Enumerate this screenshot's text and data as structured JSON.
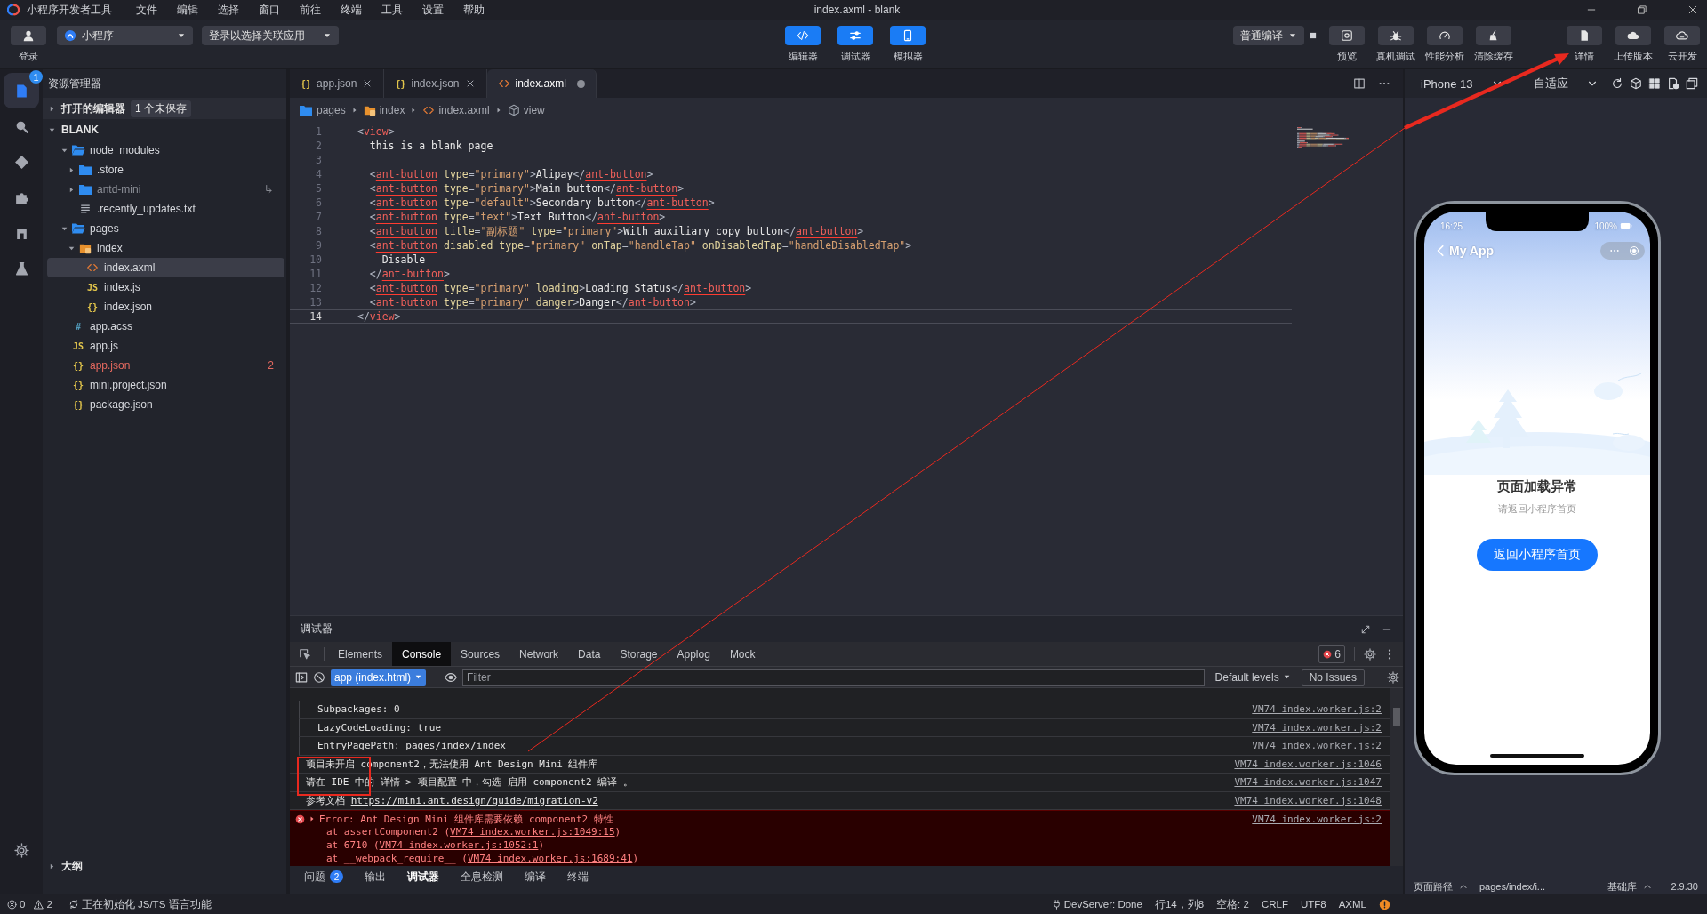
{
  "title_bar": {
    "app_name": "小程序开发者工具",
    "menu": [
      "文件",
      "编辑",
      "选择",
      "窗口",
      "前往",
      "终端",
      "工具",
      "设置",
      "帮助"
    ],
    "title": "index.axml - blank"
  },
  "toolbar": {
    "login": "登录",
    "app_type": "小程序",
    "linked_app": "登录以选择关联应用",
    "views": [
      {
        "label": "编辑器",
        "kind": "editor",
        "on": true
      },
      {
        "label": "调试器",
        "kind": "debugger",
        "on": true
      },
      {
        "label": "模拟器",
        "kind": "simulator",
        "on": true
      }
    ],
    "compile_mode": "普通编译",
    "actions": [
      {
        "label": "预览",
        "kind": "preview"
      },
      {
        "label": "真机调试",
        "kind": "remote-debug"
      },
      {
        "label": "性能分析",
        "kind": "performance"
      },
      {
        "label": "清除缓存",
        "kind": "clear-cache"
      },
      {
        "label": "详情",
        "kind": "details"
      },
      {
        "label": "上传版本",
        "kind": "upload"
      },
      {
        "label": "云开发",
        "kind": "cloud"
      }
    ]
  },
  "activity_bar": {
    "items": [
      {
        "kind": "explorer",
        "selected": true,
        "badge": "1"
      },
      {
        "kind": "search",
        "selected": false
      },
      {
        "kind": "git",
        "selected": false
      },
      {
        "kind": "extensions",
        "selected": false
      },
      {
        "kind": "layout",
        "selected": false
      },
      {
        "kind": "test",
        "selected": false
      },
      {
        "kind": "settings",
        "selected": false
      }
    ]
  },
  "explorer": {
    "title": "资源管理器",
    "open_editors": {
      "label": "打开的编辑器",
      "expanded": false,
      "badge": "1 个未保存"
    },
    "project": {
      "label": "BLANK",
      "expanded": true,
      "children": [
        {
          "name": "node_modules",
          "kind": "folder",
          "expanded": true,
          "selected": false,
          "children": [
            {
              "name": ".store",
              "kind": "folder",
              "expanded": false,
              "selected": false
            },
            {
              "name": "antd-mini",
              "kind": "folder",
              "expanded": false,
              "selected": false,
              "dimmed": true,
              "symlink": true
            },
            {
              "name": ".recently_updates.txt",
              "kind": "txt",
              "selected": false
            }
          ]
        },
        {
          "name": "pages",
          "kind": "folder",
          "expanded": true,
          "selected": false,
          "children": [
            {
              "name": "index",
              "kind": "page-folder",
              "expanded": true,
              "selected": false,
              "children": [
                {
                  "name": "index.axml",
                  "kind": "axml",
                  "selected": true
                },
                {
                  "name": "index.js",
                  "kind": "js",
                  "icon": "JS",
                  "selected": false
                },
                {
                  "name": "index.json",
                  "kind": "json",
                  "icon": "{}",
                  "selected": false
                }
              ]
            }
          ]
        },
        {
          "name": "app.acss",
          "kind": "acss",
          "icon": "#",
          "selected": false
        },
        {
          "name": "app.js",
          "kind": "js",
          "icon": "JS",
          "selected": false
        },
        {
          "name": "app.json",
          "kind": "json",
          "icon": "{}",
          "selected": false,
          "problems": "2"
        },
        {
          "name": "mini.project.json",
          "kind": "json",
          "icon": "{}",
          "selected": false
        },
        {
          "name": "package.json",
          "kind": "json",
          "icon": "{}",
          "selected": false
        }
      ]
    },
    "outline": {
      "label": "大纲",
      "expanded": false
    }
  },
  "editor": {
    "tabs": [
      {
        "label": "app.json",
        "kind": "json",
        "icon": "{}",
        "selected": false,
        "dirty": false
      },
      {
        "label": "index.json",
        "kind": "json",
        "icon": "{}",
        "selected": false,
        "dirty": false
      },
      {
        "label": "index.axml",
        "kind": "axml",
        "selected": true,
        "dirty": true
      }
    ],
    "breadcrumb": [
      {
        "label": "pages",
        "kind": "folder"
      },
      {
        "label": "index",
        "kind": "page-folder"
      },
      {
        "label": "index.axml",
        "kind": "axml"
      },
      {
        "label": "view",
        "kind": "element"
      }
    ],
    "lines": [
      {
        "number": "1",
        "current": false,
        "tokens": [
          {
            "kind": "punct",
            "text": "<"
          },
          {
            "kind": "tag",
            "text": "view"
          },
          {
            "kind": "punct",
            "text": ">"
          }
        ]
      },
      {
        "number": "2",
        "current": false,
        "tokens": [
          {
            "kind": "text",
            "text": "  this is a blank page"
          }
        ]
      },
      {
        "number": "3",
        "current": false
      },
      {
        "number": "4",
        "current": false,
        "tokens": [
          {
            "kind": "punct",
            "text": "  <"
          },
          {
            "kind": "tag-error",
            "text": "ant-button"
          },
          {
            "kind": "attr",
            "text": " type"
          },
          {
            "kind": "punct",
            "text": "="
          },
          {
            "kind": "string",
            "text": "\"primary\""
          },
          {
            "kind": "punct",
            "text": ">"
          },
          {
            "kind": "text",
            "text": "Alipay"
          },
          {
            "kind": "punct",
            "text": "</"
          },
          {
            "kind": "tag-error",
            "text": "ant-button"
          },
          {
            "kind": "punct",
            "text": ">"
          }
        ]
      },
      {
        "number": "5",
        "current": false,
        "tokens": [
          {
            "kind": "punct",
            "text": "  <"
          },
          {
            "kind": "tag-error",
            "text": "ant-button"
          },
          {
            "kind": "attr",
            "text": " type"
          },
          {
            "kind": "punct",
            "text": "="
          },
          {
            "kind": "string",
            "text": "\"primary\""
          },
          {
            "kind": "punct",
            "text": ">"
          },
          {
            "kind": "text",
            "text": "Main button"
          },
          {
            "kind": "punct",
            "text": "</"
          },
          {
            "kind": "tag-error",
            "text": "ant-button"
          },
          {
            "kind": "punct",
            "text": ">"
          }
        ]
      },
      {
        "number": "6",
        "current": false,
        "tokens": [
          {
            "kind": "punct",
            "text": "  <"
          },
          {
            "kind": "tag-error",
            "text": "ant-button"
          },
          {
            "kind": "attr",
            "text": " type"
          },
          {
            "kind": "punct",
            "text": "="
          },
          {
            "kind": "string",
            "text": "\"default\""
          },
          {
            "kind": "punct",
            "text": ">"
          },
          {
            "kind": "text",
            "text": "Secondary button"
          },
          {
            "kind": "punct",
            "text": "</"
          },
          {
            "kind": "tag-error",
            "text": "ant-button"
          },
          {
            "kind": "punct",
            "text": ">"
          }
        ]
      },
      {
        "number": "7",
        "current": false,
        "tokens": [
          {
            "kind": "punct",
            "text": "  <"
          },
          {
            "kind": "tag-error",
            "text": "ant-button"
          },
          {
            "kind": "attr",
            "text": " type"
          },
          {
            "kind": "punct",
            "text": "="
          },
          {
            "kind": "string",
            "text": "\"text\""
          },
          {
            "kind": "punct",
            "text": ">"
          },
          {
            "kind": "text",
            "text": "Text Button"
          },
          {
            "kind": "punct",
            "text": "</"
          },
          {
            "kind": "tag-error",
            "text": "ant-button"
          },
          {
            "kind": "punct",
            "text": ">"
          }
        ]
      },
      {
        "number": "8",
        "current": false,
        "tokens": [
          {
            "kind": "punct",
            "text": "  <"
          },
          {
            "kind": "tag-error",
            "text": "ant-button"
          },
          {
            "kind": "attr",
            "text": " title"
          },
          {
            "kind": "punct",
            "text": "="
          },
          {
            "kind": "string",
            "text": "\"副标题\""
          },
          {
            "kind": "attr",
            "text": " type"
          },
          {
            "kind": "punct",
            "text": "="
          },
          {
            "kind": "string",
            "text": "\"primary\""
          },
          {
            "kind": "punct",
            "text": ">"
          },
          {
            "kind": "text",
            "text": "With auxiliary copy button"
          },
          {
            "kind": "punct",
            "text": "</"
          },
          {
            "kind": "tag-error",
            "text": "ant-button"
          },
          {
            "kind": "punct",
            "text": ">"
          }
        ]
      },
      {
        "number": "9",
        "current": false,
        "tokens": [
          {
            "kind": "punct",
            "text": "  <"
          },
          {
            "kind": "tag-error",
            "text": "ant-button"
          },
          {
            "kind": "attr",
            "text": " disabled type"
          },
          {
            "kind": "punct",
            "text": "="
          },
          {
            "kind": "string",
            "text": "\"primary\""
          },
          {
            "kind": "attr",
            "text": " onTap"
          },
          {
            "kind": "punct",
            "text": "="
          },
          {
            "kind": "string",
            "text": "\"handleTap\""
          },
          {
            "kind": "attr",
            "text": " onDisabledTap"
          },
          {
            "kind": "punct",
            "text": "="
          },
          {
            "kind": "string",
            "text": "\"handleDisabledTap\""
          },
          {
            "kind": "punct",
            "text": ">"
          }
        ]
      },
      {
        "number": "10",
        "current": false,
        "tokens": [
          {
            "kind": "text",
            "text": "    Disable"
          }
        ]
      },
      {
        "number": "11",
        "current": false,
        "tokens": [
          {
            "kind": "punct",
            "text": "  </"
          },
          {
            "kind": "tag-error",
            "text": "ant-button"
          },
          {
            "kind": "punct",
            "text": ">"
          }
        ]
      },
      {
        "number": "12",
        "current": false,
        "tokens": [
          {
            "kind": "punct",
            "text": "  <"
          },
          {
            "kind": "tag-error",
            "text": "ant-button"
          },
          {
            "kind": "attr",
            "text": " type"
          },
          {
            "kind": "punct",
            "text": "="
          },
          {
            "kind": "string",
            "text": "\"primary\""
          },
          {
            "kind": "attr",
            "text": " loading"
          },
          {
            "kind": "punct",
            "text": ">"
          },
          {
            "kind": "text",
            "text": "Loading Status"
          },
          {
            "kind": "punct",
            "text": "</"
          },
          {
            "kind": "tag-error",
            "text": "ant-button"
          },
          {
            "kind": "punct",
            "text": ">"
          }
        ]
      },
      {
        "number": "13",
        "current": false,
        "tokens": [
          {
            "kind": "punct",
            "text": "  <"
          },
          {
            "kind": "tag-error",
            "text": "ant-button"
          },
          {
            "kind": "attr",
            "text": " type"
          },
          {
            "kind": "punct",
            "text": "="
          },
          {
            "kind": "string",
            "text": "\"primary\""
          },
          {
            "kind": "attr",
            "text": " danger"
          },
          {
            "kind": "punct",
            "text": ">"
          },
          {
            "kind": "text",
            "text": "Danger"
          },
          {
            "kind": "punct",
            "text": "</"
          },
          {
            "kind": "tag-error",
            "text": "ant-button"
          },
          {
            "kind": "punct",
            "text": ">"
          }
        ]
      },
      {
        "number": "14",
        "current": true,
        "tokens": [
          {
            "kind": "punct",
            "text": "</"
          },
          {
            "kind": "tag",
            "text": "view"
          },
          {
            "kind": "punct",
            "text": ">"
          }
        ]
      }
    ]
  },
  "debugger": {
    "title": "调试器",
    "tabs": [
      {
        "label": "Elements",
        "selected": false
      },
      {
        "label": "Console",
        "selected": true
      },
      {
        "label": "Sources",
        "selected": false
      },
      {
        "label": "Network",
        "selected": false
      },
      {
        "label": "Data",
        "selected": false
      },
      {
        "label": "Storage",
        "selected": false
      },
      {
        "label": "Applog",
        "selected": false
      },
      {
        "label": "Mock",
        "selected": false
      }
    ],
    "error_count": "6",
    "context": "app (index.html)",
    "filter_placeholder": "Filter",
    "levels": "Default levels",
    "issues": "No Issues",
    "logs": [
      {
        "kind": "property",
        "text": "Subpackages: 0",
        "source": "VM74 index.worker.js:2"
      },
      {
        "kind": "property",
        "text": "LazyCodeLoading: true",
        "source": "VM74 index.worker.js:2"
      },
      {
        "kind": "property",
        "text": "EntryPagePath: pages/index/index",
        "source": "VM74 index.worker.js:2"
      },
      {
        "kind": "message",
        "text": "项目未开启 component2，无法使用 Ant Design Mini 组件库",
        "source": "VM74 index.worker.js:1046"
      },
      {
        "kind": "message",
        "text": "请在 IDE 中的 详情 > 项目配置 中，勾选 启用 component2 编译 。",
        "source": "VM74 index.worker.js:1047"
      },
      {
        "kind": "message",
        "text": "参考文档",
        "link": "https://mini.ant.design/guide/migration-v2",
        "source": "VM74 index.worker.js:1048"
      },
      {
        "kind": "error",
        "text": "Error: Ant Design Mini 组件库需要依赖 component2 特性",
        "source": "VM74 index.worker.js:2",
        "stack": [
          {
            "call": "at assertComponent2 (",
            "location": "VM74 index.worker.js:1049:15",
            "suffix": ")"
          },
          {
            "call": "at 6710 (",
            "location": "VM74 index.worker.js:1052:1",
            "suffix": ")"
          },
          {
            "call": "at __webpack_require__ (",
            "location": "VM74 index.worker.js:1689:41",
            "suffix": ")"
          }
        ]
      }
    ]
  },
  "panel_tabs": [
    {
      "label": "问题",
      "badge": "2",
      "selected": false
    },
    {
      "label": "输出",
      "selected": false
    },
    {
      "label": "调试器",
      "selected": true
    },
    {
      "label": "全息检测",
      "selected": false
    },
    {
      "label": "编译",
      "selected": false
    },
    {
      "label": "终端",
      "selected": false
    }
  ],
  "simulator": {
    "device": "iPhone 13",
    "zoom": "自适应",
    "phone": {
      "time": "16:25",
      "battery": "100%",
      "nav_title": "My App",
      "heading": "页面加载异常",
      "subtitle": "请返回小程序首页",
      "button": "返回小程序首页"
    },
    "footer": {
      "path_label": "页面路径",
      "path": "pages/index/i...",
      "lib_label": "基础库",
      "lib_version": "2.9.30"
    }
  },
  "status_bar": {
    "errors": "0",
    "warnings": "2",
    "task": "正在初始化 JS/TS 语言功能",
    "server": "DevServer: Done",
    "position": "行14，列8",
    "indent": "空格: 2",
    "eol": "CRLF",
    "encoding": "UTF8",
    "language": "AXML"
  }
}
